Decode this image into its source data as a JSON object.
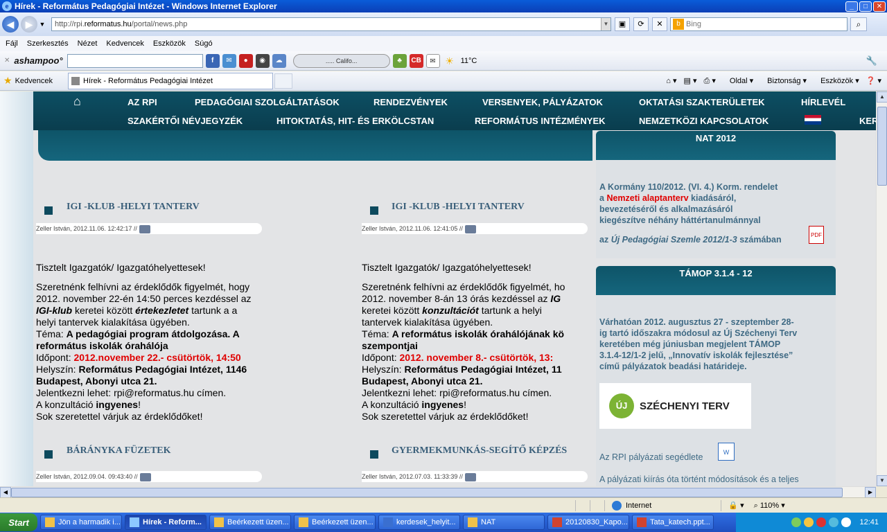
{
  "window": {
    "title": "Hírek - Református Pedagógiai Intézet - Windows Internet Explorer"
  },
  "address": {
    "prefix": "http://rpi.",
    "domain": "reformatus.hu",
    "path": "/portal/news.php",
    "search_placeholder": "Bing"
  },
  "menu": [
    "Fájl",
    "Szerkesztés",
    "Nézet",
    "Kedvencek",
    "Eszközök",
    "Súgó"
  ],
  "toolbar": {
    "brand": "ashampoo°",
    "player_label": "..... Califo...",
    "temperature": "11°C"
  },
  "favbar": {
    "favorites_label": "Kedvencek",
    "tab_title": "Hírek - Református Pedagógiai Intézet",
    "page_menu": "Oldal",
    "safety_menu": "Biztonság",
    "tools_menu": "Eszközök"
  },
  "site_nav": {
    "row1": [
      "AZ RPI",
      "PEDAGÓGIAI SZOLGÁLTATÁSOK",
      "RENDEZVÉNYEK",
      "VERSENYEK, PÁLYÁZATOK",
      "OKTATÁSI SZAKTERÜLETEK",
      "HÍRLEVÉL"
    ],
    "row2": [
      "SZAKÉRTŐI NÉVJEGYZÉK",
      "HITOKTATÁS, HIT- ÉS ERKÖLCSTAN",
      "REFORMÁTUS INTÉZMÉNYEK",
      "NEMZETKÖZI KAPCSOLATOK",
      "KER"
    ]
  },
  "articles": [
    {
      "title": "IGI -KLUB -HELYI TANTERV",
      "meta": "Zeller István, 2012.11.06. 12:42:17 //",
      "greeting": "Tisztelt Igazgatók/ Igazgatóhelyettesek!",
      "l1": "Szeretnénk felhívni az érdeklődők figyelmét, hogy",
      "l2": "2012. november 22-én 14:50 perces kezdéssel az",
      "l3a": "IGI-klub",
      "l3b": " keretei között ",
      "l3c": "értekezletet",
      "l3d": " tartunk a a",
      "l4": "helyi tantervek kialakítása ügyében.",
      "topic_label": "Téma: ",
      "topic": "A pedagógiai program átdolgozása. A",
      "topic2": "református iskolák óraháló­ja",
      "time_label": "Időpont: ",
      "time": "2012.november 22.- csütörtök, 14:50",
      "place_label": "Helyszín: ",
      "place": "Református Pedagógiai Intézet, 1146",
      "place2": "Budapest, Abonyi utca 21.",
      "reg_a": "Jelentkezni lehet: ",
      "reg_email": "rpi@reformatus.hu",
      "reg_b": " címen.",
      "cons_a": "A konzultáció ",
      "cons_b": "ingyenes",
      "cons_c": "!",
      "closing": "Sok szeretettel várjuk az érdeklődőket!"
    },
    {
      "title": "IGI -KLUB -HELYI TANTERV",
      "meta": "Zeller István, 2012.11.06. 12:41:05 //",
      "greeting": "Tisztelt Igazgatók/ Igazgatóhelyettesek!",
      "l1": "Szeretnénk felhívni az érdeklődők figyelmét, ho",
      "l2a": "2012. november 8-án 13 órás kezdéssel az ",
      "l2b": "IG",
      "l3a": "keretei között ",
      "l3b": "konzultációt",
      "l3c": " tartunk a  helyi",
      "l4": "tantervek kialakítása ügyében.",
      "topic_label": "Téma: ",
      "topic": "A református iskolák óraháló­jának kö",
      "topic2": "szempontjai",
      "time_label": "Időpont: ",
      "time": "2012. november 8.- csütörtök, 13:",
      "place_label": "Helyszín: ",
      "place": "Református Pedagógiai Intézet, 11",
      "place2": "Budapest, Abonyi utca 21.",
      "reg_a": "Jelentkezni lehet: ",
      "reg_email": "rpi@reformatus.hu",
      "reg_b": " címen.",
      "cons_a": "A konzultáció ",
      "cons_b": "ingyenes",
      "cons_c": "!",
      "closing": "Sok szeretettel várjuk az érdeklődőket!"
    },
    {
      "title": "BÁRÁNYKA FÜZETEK",
      "meta": "Zeller István, 2012.09.04. 09:43:40 //"
    },
    {
      "title": "GYERMEKMUNKÁS-SEGÍTŐ KÉPZÉS",
      "meta": "Zeller István, 2012.07.03. 11:33:39 //"
    }
  ],
  "sidebar": {
    "nat_title": "NAT 2012",
    "nat_l1": "A Kormány 110/2012. (VI. 4.) Korm. rendelet",
    "nat_l2a": "a ",
    "nat_l2b": "Nemzeti alaptanterv",
    "nat_l2c": " kiadásáról,",
    "nat_l3": "bevezetéséről és alkalmazásáról",
    "nat_l4": "kiegészítve néhány háttértanulmánnyal",
    "nat_l5a": "az ",
    "nat_l5b": "Új Pedagógiai Szemle 2012/1-3",
    "nat_l5c": " számában",
    "tamop_title": "TÁMOP 3.1.4 - 12",
    "tamop_l1": "Várhatóan 2012. augusztus 27 - szeptember 28-",
    "tamop_l2": "ig tartó időszakra módosul az Új Széchenyi Terv",
    "tamop_l3": "keretében még júniusban megjelent TÁMOP",
    "tamop_l4": "3.1.4-12/1-2 jelű, „Innovatív iskolák fejlesztése”",
    "tamop_l5": "című pályázatok beadási határideje.",
    "szt_logo": "ÚJ",
    "szt_text": "SZÉCHENYI TERV",
    "helper": "Az RPI pályázati segédlete",
    "more": "A pályázati kiírás óta történt módosítások és a teljes"
  },
  "statusbar": {
    "zone": "Internet",
    "zoom": "110%"
  },
  "taskbar": {
    "start": "Start",
    "items": [
      "Jön a harmadik i...",
      "Hírek - Reform...",
      "Beérkezett üzen...",
      "Beérkezett üzen...",
      "kerdesek_helyit...",
      "NAT",
      "20120830_Kapo...",
      "Tata_katech.ppt..."
    ],
    "clock": "12:41"
  }
}
